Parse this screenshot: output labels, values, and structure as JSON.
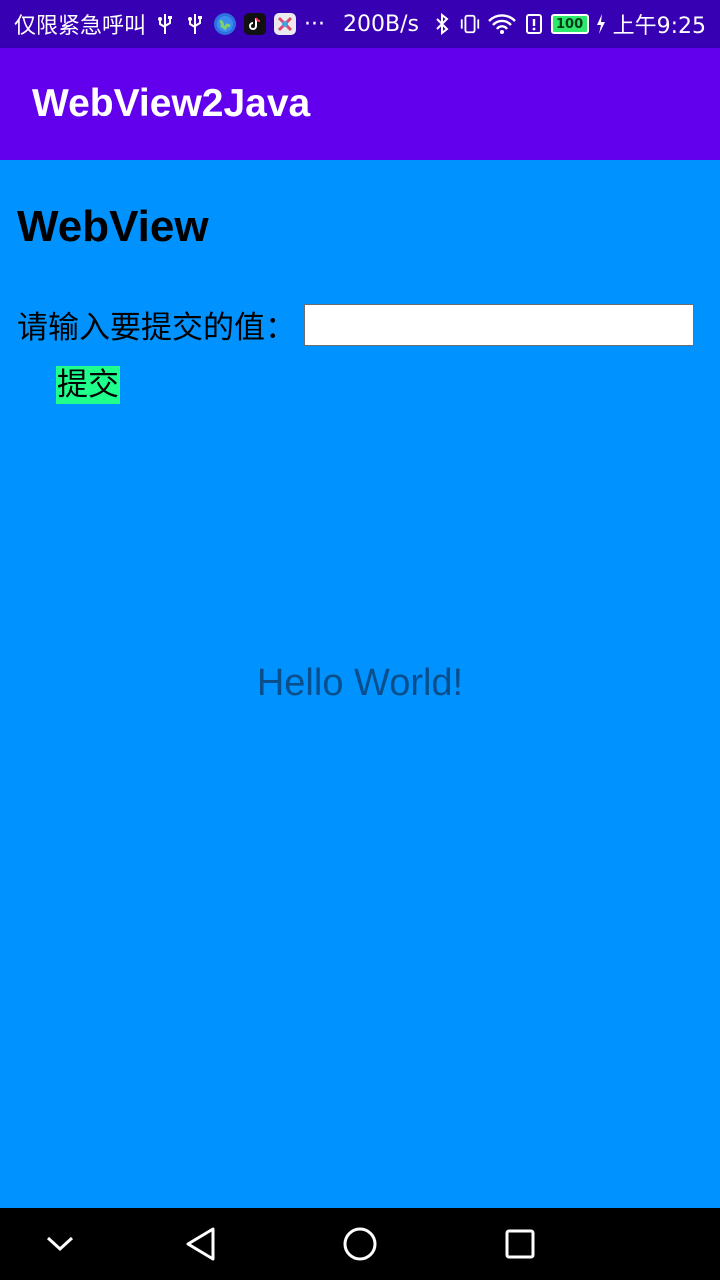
{
  "status_bar": {
    "carrier_text": "仅限紧急呼叫",
    "more_indicator": "···",
    "net_speed": "200B/s",
    "battery_level": "100",
    "time": "上午9:25",
    "icons": [
      "usb-icon",
      "usb-icon",
      "browser-icon",
      "tiktok-icon",
      "app-icon",
      "bluetooth-icon",
      "vibrate-icon",
      "wifi-icon",
      "alert-icon",
      "battery-icon",
      "charging-icon"
    ]
  },
  "app_bar": {
    "title": "WebView2Java",
    "color": "#6200ee"
  },
  "webview": {
    "heading": "WebView",
    "input_label": "请输入要提交的值：",
    "input_value": "",
    "submit_label": "提交",
    "background": "#0093ff",
    "button_color": "#1eff8c"
  },
  "main": {
    "hello_text": "Hello World!"
  },
  "nav_bar": {
    "buttons": [
      "collapse-icon",
      "back-icon",
      "home-icon",
      "recents-icon"
    ]
  }
}
